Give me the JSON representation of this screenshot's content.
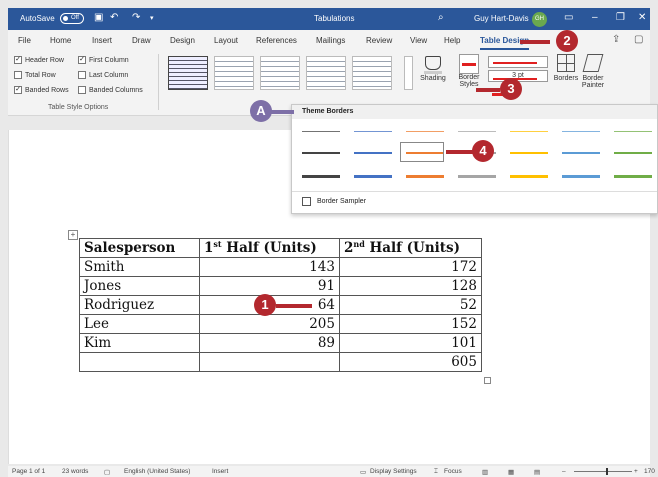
{
  "titlebar": {
    "autosave_label": "AutoSave",
    "autosave_state": "Off",
    "document_title": "Tabulations",
    "user_name": "Guy Hart-Davis",
    "user_initials": "GH"
  },
  "tabs": [
    "File",
    "Home",
    "Insert",
    "Draw",
    "Design",
    "Layout",
    "References",
    "Mailings",
    "Review",
    "View",
    "Help",
    "Table Design"
  ],
  "ribbon": {
    "style_options": {
      "header_row": "Header Row",
      "first_column": "First Column",
      "total_row": "Total Row",
      "last_column": "Last Column",
      "banded_rows": "Banded Rows",
      "banded_columns": "Banded Columns",
      "group_label": "Table Style Options"
    },
    "shading_label": "Shading",
    "border_styles_label_1": "Border",
    "border_styles_label_2": "Styles",
    "line_weight": "3 pt",
    "borders_label": "Borders",
    "border_painter_label_1": "Border",
    "border_painter_label_2": "Painter"
  },
  "dropdown": {
    "header": "Theme Borders",
    "sampler_label": "Border Sampler",
    "swatch_colors": [
      "#444444",
      "#4472c4",
      "#ed7d31",
      "#a5a5a5",
      "#ffc000",
      "#5b9bd5",
      "#70ad47"
    ]
  },
  "table": {
    "headers": [
      "Salesperson",
      "1st Half (Units)",
      "2nd Half (Units)"
    ],
    "h1_base": "1",
    "h1_sup": "st",
    "h1_rest": " Half (Units)",
    "h2_base": "2",
    "h2_sup": "nd",
    "h2_rest": " Half (Units)",
    "rows": [
      [
        "Smith",
        "143",
        "172"
      ],
      [
        "Jones",
        "91",
        "128"
      ],
      [
        "Rodriguez",
        "64",
        "52"
      ],
      [
        "Lee",
        "205",
        "152"
      ],
      [
        "Kim",
        "89",
        "101"
      ],
      [
        "",
        "",
        "605"
      ]
    ]
  },
  "statusbar": {
    "page": "Page 1 of 1",
    "words": "23 words",
    "language": "English (United States)",
    "mode": "Insert",
    "display_settings": "Display Settings",
    "focus": "Focus",
    "zoom": "170"
  },
  "callouts": {
    "one": "1",
    "two": "2",
    "three": "3",
    "four": "4",
    "a": "A"
  },
  "colors": {
    "accent": "#2b579a",
    "callout_red": "#b3282e",
    "callout_purple": "#7d6fa7",
    "border_red": "#e02020"
  }
}
